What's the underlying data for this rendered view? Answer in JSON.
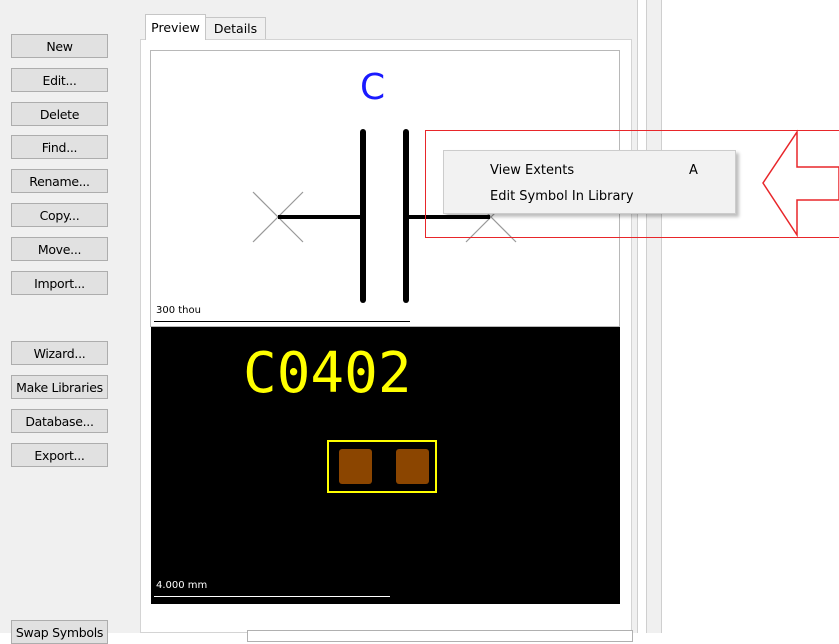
{
  "toolbar": {
    "new": "New",
    "edit": "Edit...",
    "delete": "Delete",
    "find": "Find...",
    "rename": "Rename...",
    "copy": "Copy...",
    "move": "Move...",
    "import": "Import...",
    "wizard": "Wizard...",
    "make_libraries": "Make Libraries",
    "database": "Database...",
    "export": "Export...",
    "swap_symbols": "Swap Symbols"
  },
  "tabs": {
    "preview": "Preview",
    "details": "Details"
  },
  "symbol_preview": {
    "name": "C",
    "scale_label": "300 thou"
  },
  "footprint_preview": {
    "name": "C0402",
    "scale_label": "4.000 mm"
  },
  "context_menu": {
    "items": [
      {
        "label": "View Extents",
        "shortcut": "A"
      },
      {
        "label": "Edit Symbol In Library",
        "shortcut": ""
      }
    ]
  },
  "colors": {
    "symbol_name": "#1a1aff",
    "footprint": "#ffff00",
    "pad": "#8b4500",
    "annotation": "#e8262a"
  },
  "icons": [
    "pin-end-x-icon",
    "annotation-arrow-icon"
  ]
}
